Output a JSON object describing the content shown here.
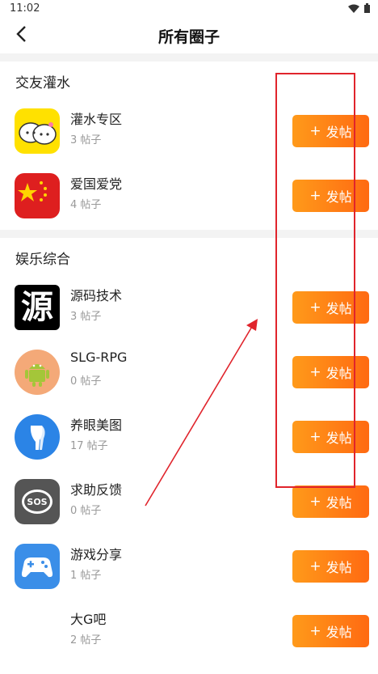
{
  "status": {
    "time": "11:02"
  },
  "header": {
    "title": "所有圈子"
  },
  "sections": [
    {
      "title": "交友灌水",
      "items": [
        {
          "name": "灌水专区",
          "count": "3 帖子",
          "icon": "chat-bubbles-icon"
        },
        {
          "name": "爱国爱党",
          "count": "4 帖子",
          "icon": "china-flag-icon"
        }
      ]
    },
    {
      "title": "娱乐综合",
      "items": [
        {
          "name": "源码技术",
          "count": "3 帖子",
          "icon": "yuan-character-icon",
          "glyph": "源"
        },
        {
          "name": "SLG-RPG",
          "count": "0 帖子",
          "icon": "android-robot-icon"
        },
        {
          "name": "养眼美图",
          "count": "17 帖子",
          "icon": "leg-icon"
        },
        {
          "name": "求助反馈",
          "count": "0 帖子",
          "icon": "sos-bubble-icon",
          "glyph": "SOS"
        },
        {
          "name": "游戏分享",
          "count": "1 帖子",
          "icon": "gamepad-icon"
        },
        {
          "name": "大G吧",
          "count": "2 帖子",
          "icon": "blank-icon"
        }
      ]
    }
  ],
  "post_button_label": "发帖",
  "colors": {
    "button_start": "#ff9a1a",
    "button_end": "#ff6a12",
    "annotation": "#e0242c"
  }
}
